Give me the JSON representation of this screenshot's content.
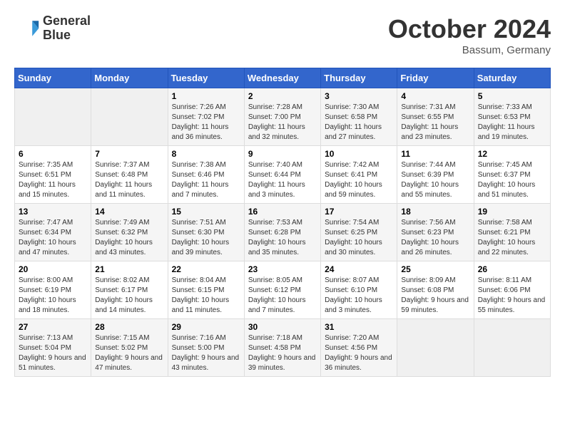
{
  "header": {
    "logo_line1": "General",
    "logo_line2": "Blue",
    "month": "October 2024",
    "location": "Bassum, Germany"
  },
  "days_of_week": [
    "Sunday",
    "Monday",
    "Tuesday",
    "Wednesday",
    "Thursday",
    "Friday",
    "Saturday"
  ],
  "weeks": [
    [
      {
        "day": "",
        "info": ""
      },
      {
        "day": "",
        "info": ""
      },
      {
        "day": "1",
        "info": "Sunrise: 7:26 AM\nSunset: 7:02 PM\nDaylight: 11 hours and 36 minutes."
      },
      {
        "day": "2",
        "info": "Sunrise: 7:28 AM\nSunset: 7:00 PM\nDaylight: 11 hours and 32 minutes."
      },
      {
        "day": "3",
        "info": "Sunrise: 7:30 AM\nSunset: 6:58 PM\nDaylight: 11 hours and 27 minutes."
      },
      {
        "day": "4",
        "info": "Sunrise: 7:31 AM\nSunset: 6:55 PM\nDaylight: 11 hours and 23 minutes."
      },
      {
        "day": "5",
        "info": "Sunrise: 7:33 AM\nSunset: 6:53 PM\nDaylight: 11 hours and 19 minutes."
      }
    ],
    [
      {
        "day": "6",
        "info": "Sunrise: 7:35 AM\nSunset: 6:51 PM\nDaylight: 11 hours and 15 minutes."
      },
      {
        "day": "7",
        "info": "Sunrise: 7:37 AM\nSunset: 6:48 PM\nDaylight: 11 hours and 11 minutes."
      },
      {
        "day": "8",
        "info": "Sunrise: 7:38 AM\nSunset: 6:46 PM\nDaylight: 11 hours and 7 minutes."
      },
      {
        "day": "9",
        "info": "Sunrise: 7:40 AM\nSunset: 6:44 PM\nDaylight: 11 hours and 3 minutes."
      },
      {
        "day": "10",
        "info": "Sunrise: 7:42 AM\nSunset: 6:41 PM\nDaylight: 10 hours and 59 minutes."
      },
      {
        "day": "11",
        "info": "Sunrise: 7:44 AM\nSunset: 6:39 PM\nDaylight: 10 hours and 55 minutes."
      },
      {
        "day": "12",
        "info": "Sunrise: 7:45 AM\nSunset: 6:37 PM\nDaylight: 10 hours and 51 minutes."
      }
    ],
    [
      {
        "day": "13",
        "info": "Sunrise: 7:47 AM\nSunset: 6:34 PM\nDaylight: 10 hours and 47 minutes."
      },
      {
        "day": "14",
        "info": "Sunrise: 7:49 AM\nSunset: 6:32 PM\nDaylight: 10 hours and 43 minutes."
      },
      {
        "day": "15",
        "info": "Sunrise: 7:51 AM\nSunset: 6:30 PM\nDaylight: 10 hours and 39 minutes."
      },
      {
        "day": "16",
        "info": "Sunrise: 7:53 AM\nSunset: 6:28 PM\nDaylight: 10 hours and 35 minutes."
      },
      {
        "day": "17",
        "info": "Sunrise: 7:54 AM\nSunset: 6:25 PM\nDaylight: 10 hours and 30 minutes."
      },
      {
        "day": "18",
        "info": "Sunrise: 7:56 AM\nSunset: 6:23 PM\nDaylight: 10 hours and 26 minutes."
      },
      {
        "day": "19",
        "info": "Sunrise: 7:58 AM\nSunset: 6:21 PM\nDaylight: 10 hours and 22 minutes."
      }
    ],
    [
      {
        "day": "20",
        "info": "Sunrise: 8:00 AM\nSunset: 6:19 PM\nDaylight: 10 hours and 18 minutes."
      },
      {
        "day": "21",
        "info": "Sunrise: 8:02 AM\nSunset: 6:17 PM\nDaylight: 10 hours and 14 minutes."
      },
      {
        "day": "22",
        "info": "Sunrise: 8:04 AM\nSunset: 6:15 PM\nDaylight: 10 hours and 11 minutes."
      },
      {
        "day": "23",
        "info": "Sunrise: 8:05 AM\nSunset: 6:12 PM\nDaylight: 10 hours and 7 minutes."
      },
      {
        "day": "24",
        "info": "Sunrise: 8:07 AM\nSunset: 6:10 PM\nDaylight: 10 hours and 3 minutes."
      },
      {
        "day": "25",
        "info": "Sunrise: 8:09 AM\nSunset: 6:08 PM\nDaylight: 9 hours and 59 minutes."
      },
      {
        "day": "26",
        "info": "Sunrise: 8:11 AM\nSunset: 6:06 PM\nDaylight: 9 hours and 55 minutes."
      }
    ],
    [
      {
        "day": "27",
        "info": "Sunrise: 7:13 AM\nSunset: 5:04 PM\nDaylight: 9 hours and 51 minutes."
      },
      {
        "day": "28",
        "info": "Sunrise: 7:15 AM\nSunset: 5:02 PM\nDaylight: 9 hours and 47 minutes."
      },
      {
        "day": "29",
        "info": "Sunrise: 7:16 AM\nSunset: 5:00 PM\nDaylight: 9 hours and 43 minutes."
      },
      {
        "day": "30",
        "info": "Sunrise: 7:18 AM\nSunset: 4:58 PM\nDaylight: 9 hours and 39 minutes."
      },
      {
        "day": "31",
        "info": "Sunrise: 7:20 AM\nSunset: 4:56 PM\nDaylight: 9 hours and 36 minutes."
      },
      {
        "day": "",
        "info": ""
      },
      {
        "day": "",
        "info": ""
      }
    ]
  ]
}
